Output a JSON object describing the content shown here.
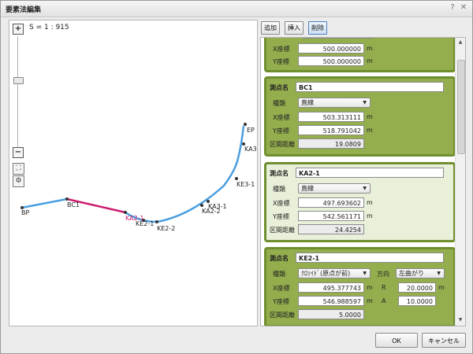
{
  "window": {
    "title": "要素法編集"
  },
  "map": {
    "scale_text": "S = 1 : 915",
    "points": [
      {
        "label": "BP"
      },
      {
        "label": "BC1"
      },
      {
        "label": "KA2-1"
      },
      {
        "label": "KE2-1"
      },
      {
        "label": "KE2-2"
      },
      {
        "label": "KA2-2"
      },
      {
        "label": "KA3-1"
      },
      {
        "label": "KE3-1"
      },
      {
        "label": "KA3"
      },
      {
        "label": "EP"
      }
    ]
  },
  "toolbar": {
    "add_label": "追加",
    "insert_label": "挿入",
    "delete_label": "削除"
  },
  "cards": [
    {
      "x_label": "X座標",
      "x_value": "500.000000",
      "y_label": "Y座標",
      "y_value": "500.000000",
      "unit": "m"
    },
    {
      "name_label": "測点名",
      "name": "BC1",
      "type_label": "種類",
      "type": "直線",
      "x_label": "X座標",
      "x_value": "503.313111",
      "y_label": "Y座標",
      "y_value": "518.791042",
      "dist_label": "区間距離",
      "dist_value": "19.0809",
      "unit": "m"
    },
    {
      "name_label": "測点名",
      "name": "KA2-1",
      "type_label": "種類",
      "type": "直線",
      "x_label": "X座標",
      "x_value": "497.693602",
      "y_label": "Y座標",
      "y_value": "542.561171",
      "dist_label": "区間距離",
      "dist_value": "24.4254",
      "unit": "m"
    },
    {
      "name_label": "測点名",
      "name": "KE2-1",
      "type_label": "種類",
      "type": "ｸﾛｿｲﾄﾞ(原点が前)",
      "direction_label": "方向",
      "direction": "左曲がり",
      "x_label": "X座標",
      "x_value": "495.377743",
      "y_label": "Y座標",
      "y_value": "546.988597",
      "r_label": "R",
      "r_value": "20.0000",
      "a_label": "A",
      "a_value": "10.0000",
      "dist_label": "区間距離",
      "dist_value": "5.0000",
      "unit": "m"
    }
  ],
  "buttons": {
    "ok_label": "OK",
    "cancel_label": "キャンセル"
  },
  "colors": {
    "selected_segment": "#cc1a6e",
    "route_line": "#4a9ee0",
    "card_border": "#6f8f2e",
    "card_selected_bg": "#94ae4e",
    "card_bg": "#e9f0d9"
  }
}
